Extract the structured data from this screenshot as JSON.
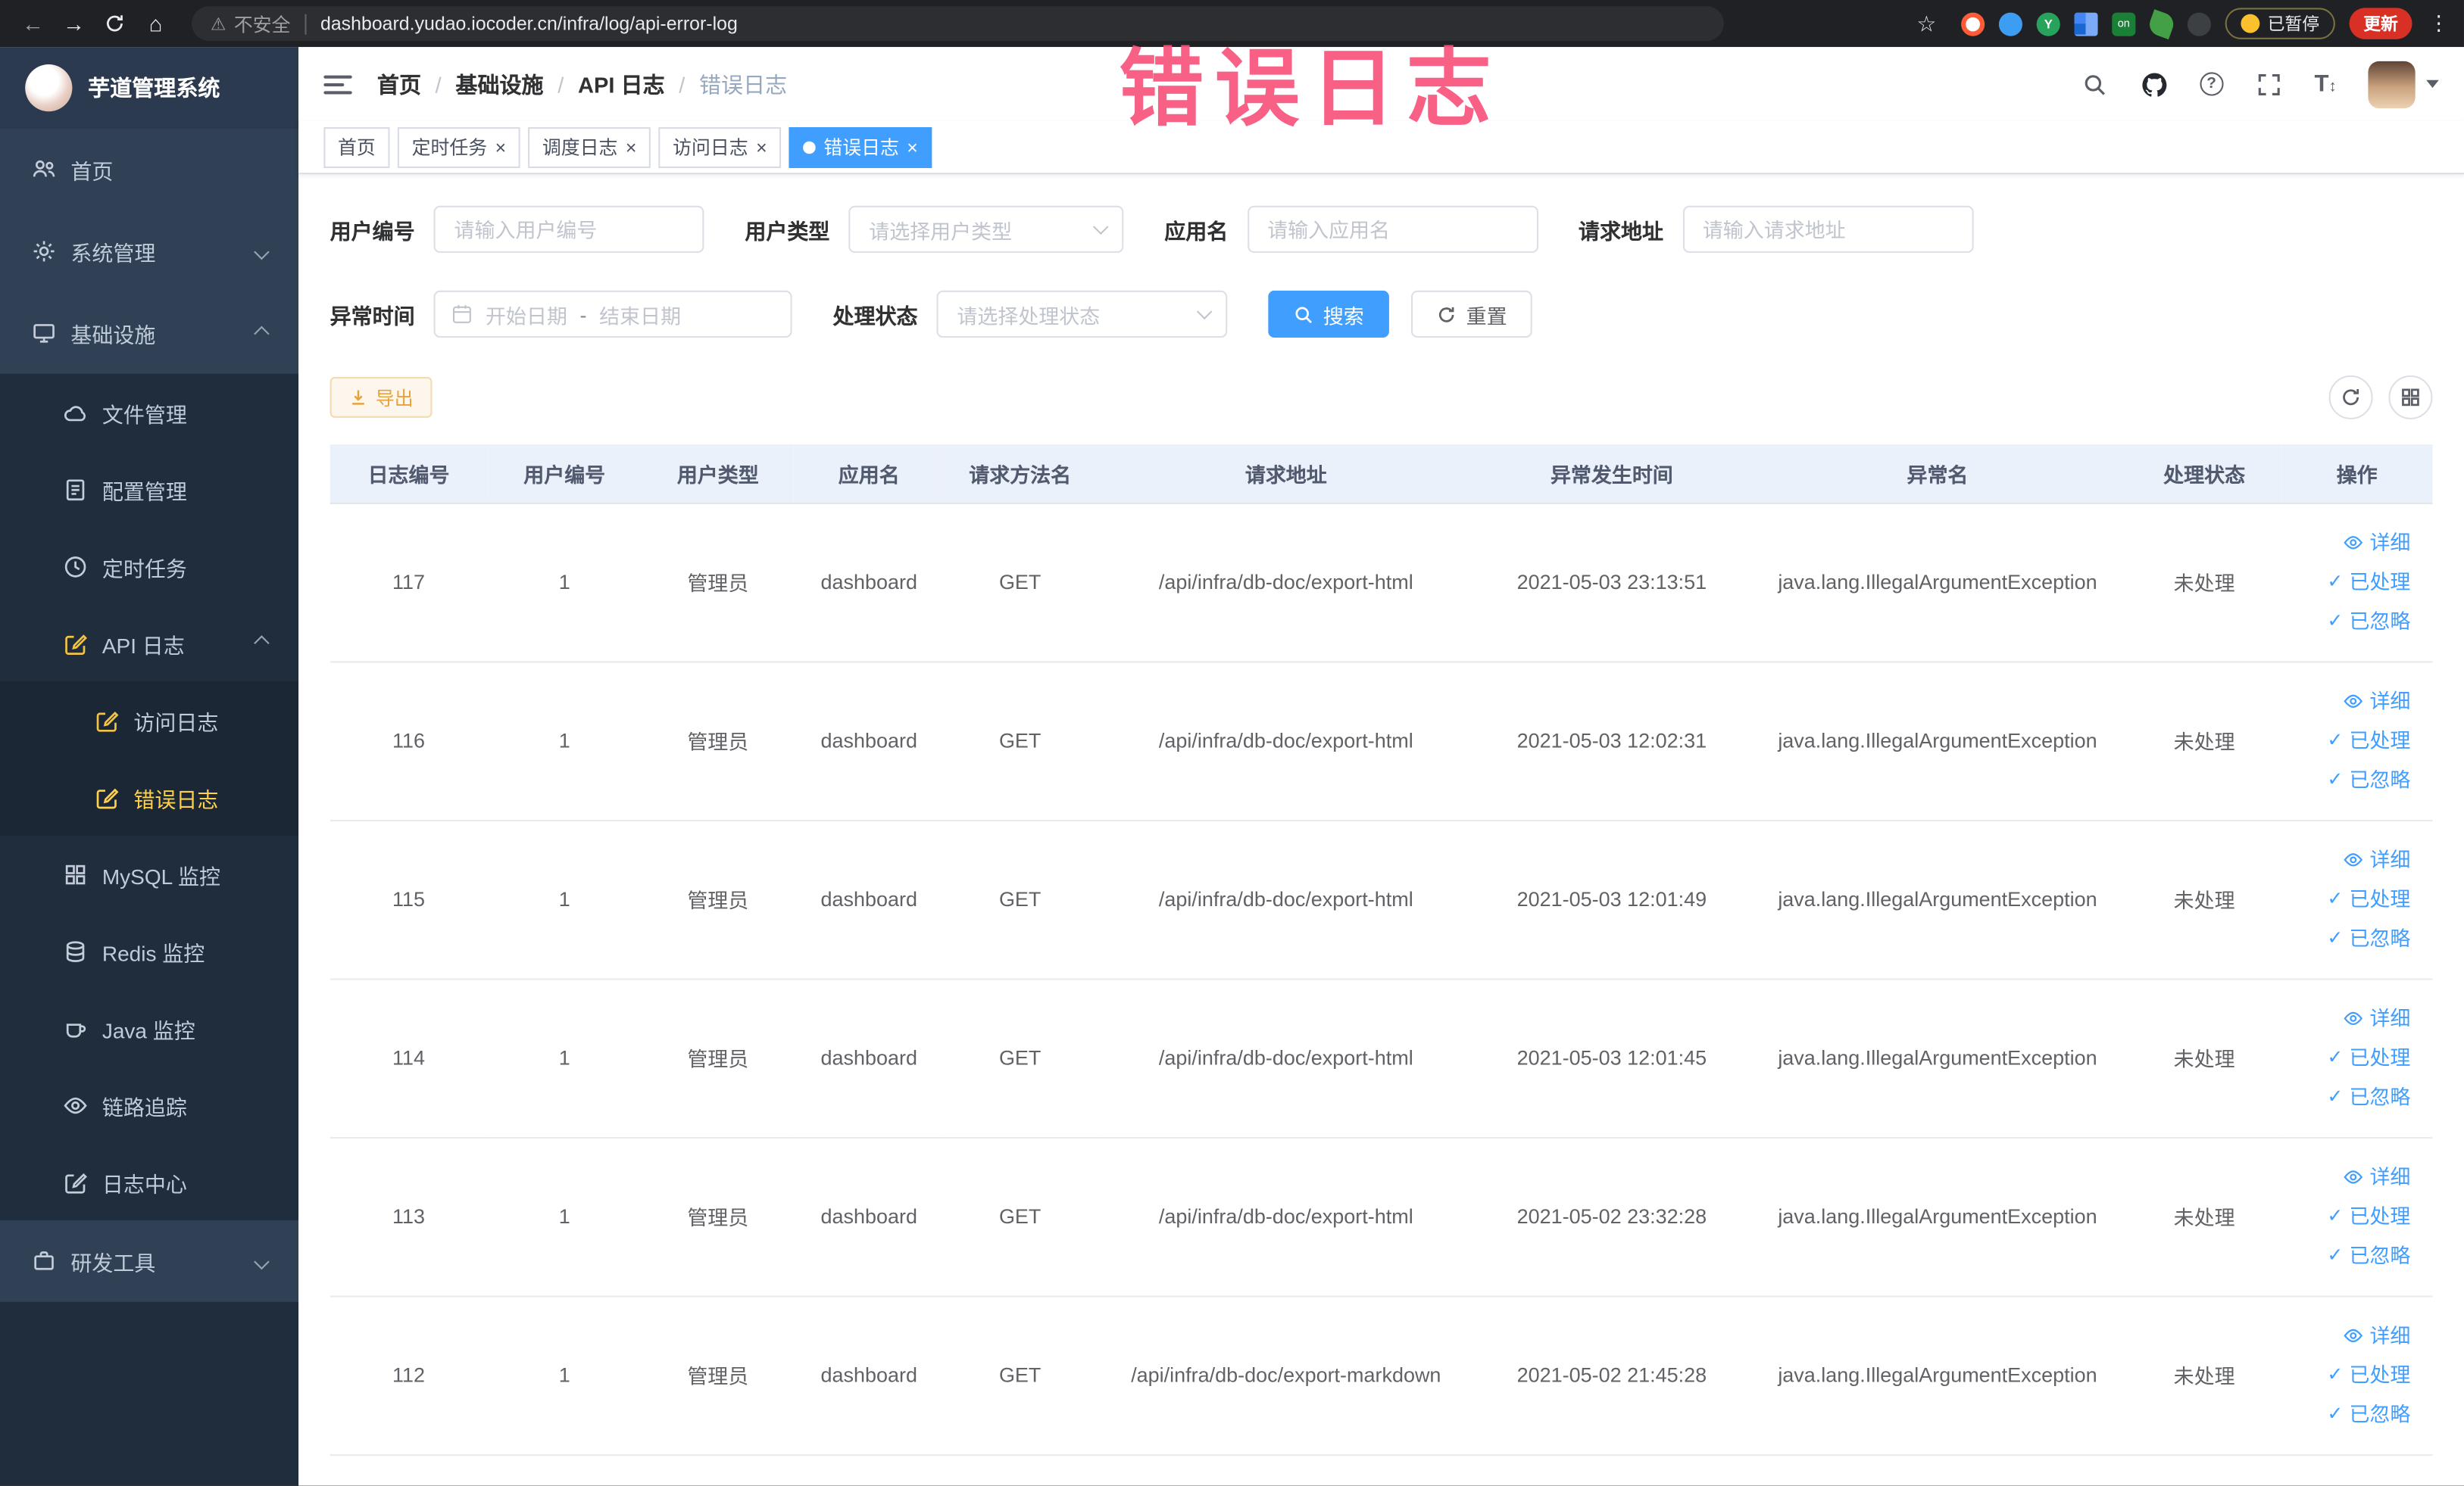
{
  "annotation": {
    "text": "错误日志",
    "color": "#f9527c"
  },
  "browser": {
    "security_label": "不安全",
    "url": "dashboard.yudao.iocoder.cn/infra/log/api-error-log",
    "ext_y_label": "Y",
    "ext_on_label": "on",
    "paused_label": "已暂停",
    "update_label": "更新"
  },
  "colors": {
    "accent": "#409eff",
    "sidebar_bg": "#304156",
    "sidebar_active": "#ffd04b",
    "warning": "#e6a23c",
    "update_badge": "#d93025"
  },
  "sidebar": {
    "logo_title": "芋道管理系统",
    "items": [
      {
        "label": "首页"
      },
      {
        "label": "系统管理"
      },
      {
        "label": "基础设施"
      },
      {
        "label": "文件管理"
      },
      {
        "label": "配置管理"
      },
      {
        "label": "定时任务"
      },
      {
        "label": "API 日志"
      },
      {
        "label": "访问日志"
      },
      {
        "label": "错误日志"
      },
      {
        "label": "MySQL 监控"
      },
      {
        "label": "Redis 监控"
      },
      {
        "label": "Java 监控"
      },
      {
        "label": "链路追踪"
      },
      {
        "label": "日志中心"
      },
      {
        "label": "研发工具"
      }
    ]
  },
  "navbar": {
    "breadcrumb": [
      "首页",
      "基础设施",
      "API 日志",
      "错误日志"
    ],
    "help_glyph": "?"
  },
  "tags": {
    "items": [
      {
        "label": "首页"
      },
      {
        "label": "定时任务"
      },
      {
        "label": "调度日志"
      },
      {
        "label": "访问日志"
      },
      {
        "label": "错误日志"
      }
    ]
  },
  "filters": {
    "user_id_label": "用户编号",
    "user_id_placeholder": "请输入用户编号",
    "user_type_label": "用户类型",
    "user_type_placeholder": "请选择用户类型",
    "app_name_label": "应用名",
    "app_name_placeholder": "请输入应用名",
    "request_url_label": "请求地址",
    "request_url_placeholder": "请输入请求地址",
    "exception_time_label": "异常时间",
    "start_date_placeholder": "开始日期",
    "date_separator": "-",
    "end_date_placeholder": "结束日期",
    "process_status_label": "处理状态",
    "process_status_placeholder": "请选择处理状态",
    "search_label": "搜索",
    "reset_label": "重置"
  },
  "toolbar": {
    "export_label": "导出"
  },
  "table": {
    "columns": [
      "日志编号",
      "用户编号",
      "用户类型",
      "应用名",
      "请求方法名",
      "请求地址",
      "异常发生时间",
      "异常名",
      "处理状态",
      "操作"
    ],
    "actions": {
      "detail": "详细",
      "processed": "已处理",
      "ignored": "已忽略"
    },
    "rows": [
      {
        "id": "117",
        "user_id": "1",
        "user_type": "管理员",
        "app": "dashboard",
        "method": "GET",
        "url": "/api/infra/db-doc/export-html",
        "time": "2021-05-03 23:13:51",
        "exception": "java.lang.IllegalArgumentException",
        "status": "未处理"
      },
      {
        "id": "116",
        "user_id": "1",
        "user_type": "管理员",
        "app": "dashboard",
        "method": "GET",
        "url": "/api/infra/db-doc/export-html",
        "time": "2021-05-03 12:02:31",
        "exception": "java.lang.IllegalArgumentException",
        "status": "未处理"
      },
      {
        "id": "115",
        "user_id": "1",
        "user_type": "管理员",
        "app": "dashboard",
        "method": "GET",
        "url": "/api/infra/db-doc/export-html",
        "time": "2021-05-03 12:01:49",
        "exception": "java.lang.IllegalArgumentException",
        "status": "未处理"
      },
      {
        "id": "114",
        "user_id": "1",
        "user_type": "管理员",
        "app": "dashboard",
        "method": "GET",
        "url": "/api/infra/db-doc/export-html",
        "time": "2021-05-03 12:01:45",
        "exception": "java.lang.IllegalArgumentException",
        "status": "未处理"
      },
      {
        "id": "113",
        "user_id": "1",
        "user_type": "管理员",
        "app": "dashboard",
        "method": "GET",
        "url": "/api/infra/db-doc/export-html",
        "time": "2021-05-02 23:32:28",
        "exception": "java.lang.IllegalArgumentException",
        "status": "未处理"
      },
      {
        "id": "112",
        "user_id": "1",
        "user_type": "管理员",
        "app": "dashboard",
        "method": "GET",
        "url": "/api/infra/db-doc/export-markdown",
        "time": "2021-05-02 21:45:28",
        "exception": "java.lang.IllegalArgumentException",
        "status": "未处理"
      }
    ]
  }
}
